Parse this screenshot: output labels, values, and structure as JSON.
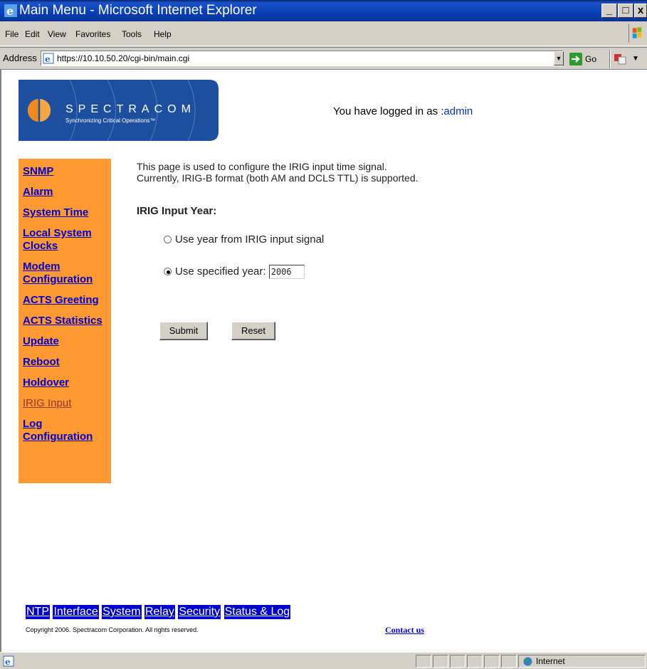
{
  "window": {
    "title": "Main Menu - Microsoft Internet Explorer",
    "minimize": "_",
    "maximize": "□",
    "close": "x"
  },
  "menu": {
    "file": "File",
    "edit": "Edit",
    "view": "View",
    "favorites": "Favorites",
    "tools": "Tools",
    "help": "Help"
  },
  "address": {
    "label": "Address",
    "url": "https://10.10.50.20/cgi-bin/main.cgi",
    "go": "Go"
  },
  "header": {
    "brand": "SPECTRACOM",
    "tagline": "Synchronizing Critical Operations™",
    "logged_in_prefix": "You have logged in as :",
    "username": "admin"
  },
  "sidebar": {
    "items": [
      {
        "label": "SNMP"
      },
      {
        "label": "Alarm"
      },
      {
        "label": "System Time"
      },
      {
        "label": "Local System Clocks"
      },
      {
        "label": "Modem Configuration"
      },
      {
        "label": "ACTS Greeting"
      },
      {
        "label": "ACTS Statistics"
      },
      {
        "label": "Update"
      },
      {
        "label": "Reboot"
      },
      {
        "label": "Holdover"
      },
      {
        "label": "IRIG Input",
        "current": true
      },
      {
        "label": "Log Configuration"
      }
    ]
  },
  "main": {
    "desc_line1": "This page is used to configure the IRIG input time signal.",
    "desc_line2": "Currently, IRIG-B format (both AM and DCLS TTL) is supported.",
    "section_title": "IRIG Input Year:",
    "option_signal": "Use year from IRIG input signal",
    "option_specified": "Use specified year:",
    "selected_option": "specified",
    "year_value": "2006",
    "submit": "Submit",
    "reset": "Reset"
  },
  "bottom_nav": [
    "NTP",
    "Interface",
    "System",
    "Relay",
    "Security",
    "Status & Log"
  ],
  "footer": {
    "copyright": "Copyright 2006. Spectracom Corporation. All rights reserved.",
    "contact": "Contact us"
  },
  "status": {
    "zone": "Internet"
  },
  "colors": {
    "sidebar_bg": "#ff9a33",
    "link": "#0000cc",
    "current_link": "#993333",
    "bottom_nav_bg": "#0000cc",
    "logo_blue": "#1e4f9e"
  }
}
